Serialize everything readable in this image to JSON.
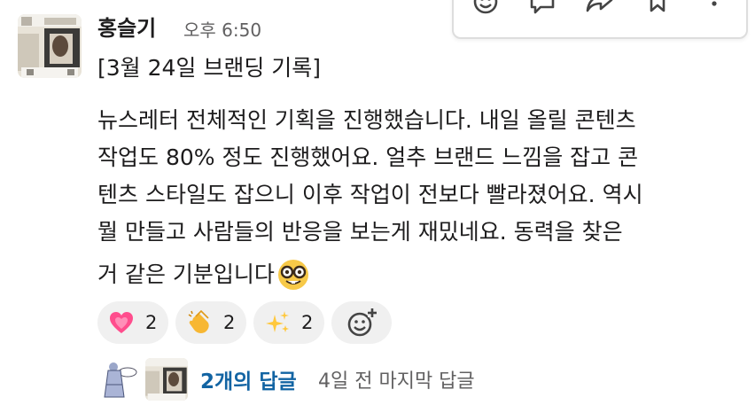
{
  "message": {
    "author": "홍슬기",
    "time": "오후 6:50",
    "lines": [
      "[3월 24일 브랜딩 기록]",
      "뉴스레터 전체적인 기획을 진행했습니다. 내일 올릴 콘텐츠",
      "작업도 80% 정도 진행했어요. 얼추 브랜드 느낌을 잡고 콘",
      "텐츠 스타일도 잡으니 이후 작업이 전보다 빨라졌어요. 역시",
      "뭘 만들고 사람들의 반응을 보는게 재밌네요. 동력을 찾은",
      "거 같은 기분입니다"
    ],
    "trailing_emoji": "nerd-face-icon"
  },
  "reactions": [
    {
      "emoji": "growing-heart-icon",
      "count": "2"
    },
    {
      "emoji": "clapping-hands-icon",
      "count": "2"
    },
    {
      "emoji": "sparkles-icon",
      "count": "2"
    }
  ],
  "thread": {
    "reply_count": "2개의 답글",
    "last_reply": "4일 전 마지막 답글"
  },
  "hover_toolbar": {
    "icons": [
      "add-reaction-icon",
      "reply-in-thread-icon",
      "share-icon",
      "bookmark-icon",
      "more-icon"
    ]
  },
  "colors": {
    "text": "#1d1c1d",
    "muted": "#616061",
    "link": "#1264a3",
    "pill": "#f0f0f0"
  }
}
